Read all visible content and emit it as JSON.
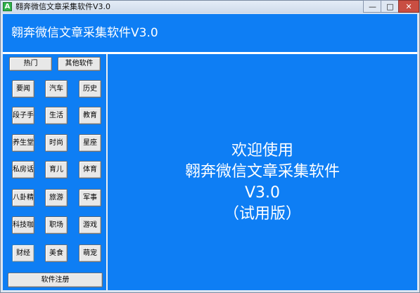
{
  "window": {
    "title": "翱奔微信文章采集软件V3.0",
    "app_icon": "A",
    "min_label": "—",
    "max_label": "□",
    "close_label": "✕"
  },
  "header": {
    "title": "翱奔微信文章采集软件V3.0"
  },
  "tabs": {
    "hot": "热门",
    "other": "其他软件"
  },
  "categories": [
    [
      "要闻",
      "汽车",
      "历史"
    ],
    [
      "段子手",
      "生活",
      "教育"
    ],
    [
      "养生堂",
      "时尚",
      "星座"
    ],
    [
      "私房话",
      "育儿",
      "体育"
    ],
    [
      "八卦精",
      "旅游",
      "军事"
    ],
    [
      "科技咖",
      "职场",
      "游戏"
    ],
    [
      "财经",
      "美食",
      "萌宠"
    ]
  ],
  "register_label": "软件注册",
  "welcome": {
    "line1": "欢迎使用",
    "line2": "翱奔微信文章采集软件",
    "line3": "V3.0",
    "line4": "（试用版）"
  },
  "colors": {
    "accent": "#0e7ef4",
    "close": "#c94e42"
  }
}
